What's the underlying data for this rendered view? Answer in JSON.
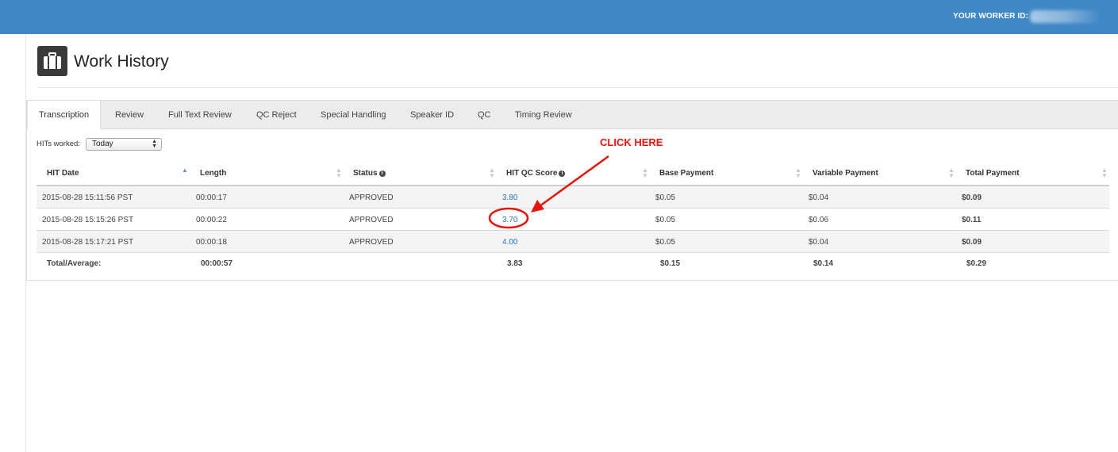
{
  "topbar": {
    "worker_id_label": "YOUR WORKER ID:"
  },
  "header": {
    "title": "Work History",
    "icon": "briefcase-icon"
  },
  "tabs": [
    {
      "label": "Transcription",
      "active": true
    },
    {
      "label": "Review"
    },
    {
      "label": "Full Text Review"
    },
    {
      "label": "QC Reject"
    },
    {
      "label": "Special Handling"
    },
    {
      "label": "Speaker ID"
    },
    {
      "label": "QC"
    },
    {
      "label": "Timing Review"
    }
  ],
  "filter": {
    "label": "HITs worked:",
    "selected": "Today"
  },
  "table": {
    "columns": [
      "HIT Date",
      "Length",
      "Status",
      "HIT QC Score",
      "Base Payment",
      "Variable Payment",
      "Total Payment"
    ],
    "sorted_column": "HIT Date",
    "rows": [
      [
        "2015-08-28 15:11:56 PST",
        "00:00:17",
        "APPROVED",
        "3.80",
        "$0.05",
        "$0.04",
        "$0.09"
      ],
      [
        "2015-08-28 15:15:26 PST",
        "00:00:22",
        "APPROVED",
        "3.70",
        "$0.05",
        "$0.06",
        "$0.11"
      ],
      [
        "2015-08-28 15:17:21 PST",
        "00:00:18",
        "APPROVED",
        "4.00",
        "$0.05",
        "$0.04",
        "$0.09"
      ]
    ],
    "totals": [
      "Total/Average:",
      "00:00:57",
      "",
      "3.83",
      "$0.15",
      "$0.14",
      "$0.29"
    ]
  },
  "annotation": {
    "text": "CLICK HERE",
    "color": "#e8140c"
  },
  "colors": {
    "topbar": "#3f87c7",
    "link": "#2a74c5"
  }
}
